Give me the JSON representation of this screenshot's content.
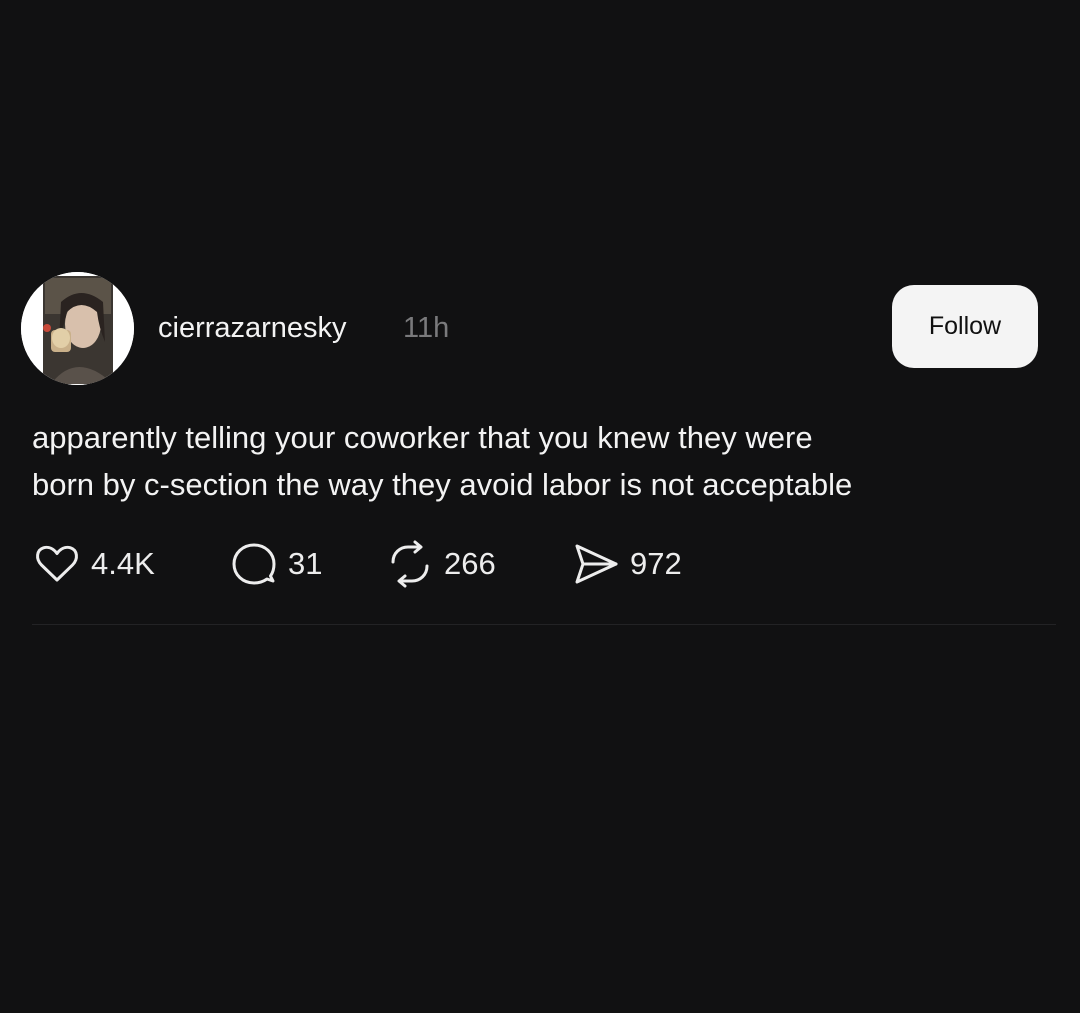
{
  "post": {
    "username": "cierrazarnesky",
    "timestamp": "11h",
    "follow_label": "Follow",
    "text_lines": [
      "apparently telling your coworker that you knew they were",
      "born by c-section the way they avoid labor is not acceptable"
    ],
    "stats": {
      "likes": "4.4K",
      "replies": "31",
      "reposts": "266",
      "shares": "972"
    },
    "icons": {
      "like": "heart-icon",
      "reply": "speech-bubble-icon",
      "repost": "repost-arrows-icon",
      "share": "paper-plane-icon"
    }
  },
  "colors": {
    "background": "#111112",
    "text": "#f3f3f3",
    "timestamp": "#7a7a7c",
    "follow_button_bg": "#f4f4f4",
    "follow_button_text": "#111111"
  }
}
